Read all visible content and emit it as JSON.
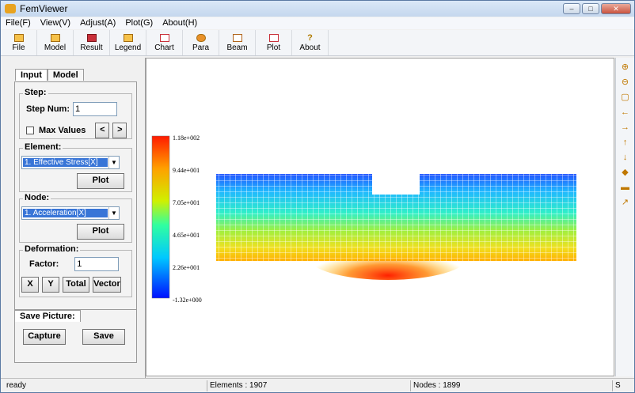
{
  "window": {
    "title": "FemViewer"
  },
  "menu": [
    "File(F)",
    "View(V)",
    "Adjust(A)",
    "Plot(G)",
    "About(H)"
  ],
  "toolbar": [
    {
      "label": "File",
      "icon": "open-folder-icon"
    },
    {
      "label": "Model",
      "icon": "model-icon"
    },
    {
      "label": "Result",
      "icon": "result-icon"
    },
    {
      "label": "Legend",
      "icon": "legend-icon"
    },
    {
      "label": "Chart",
      "icon": "chart-icon"
    },
    {
      "label": "Para",
      "icon": "para-icon"
    },
    {
      "label": "Beam",
      "icon": "beam-icon"
    },
    {
      "label": "Plot",
      "icon": "plot-icon"
    },
    {
      "label": "About",
      "icon": "about-icon"
    }
  ],
  "tabs": {
    "input": "Input",
    "model": "Model"
  },
  "step": {
    "group_label": "Step:",
    "step_num_label": "Step Num:",
    "step_num_value": "1",
    "max_values_label": "Max Values",
    "prev": "<",
    "next": ">"
  },
  "element": {
    "group_label": "Element:",
    "selected": "1. Effective Stress[X]",
    "plot": "Plot"
  },
  "node": {
    "group_label": "Node:",
    "selected": "1. Acceleration[X]",
    "plot": "Plot"
  },
  "deformation": {
    "group_label": "Deformation:",
    "factor_label": "Factor:",
    "factor_value": "1",
    "x": "X",
    "y": "Y",
    "total": "Total",
    "vector": "Vector"
  },
  "save": {
    "label": "Save Picture:",
    "capture": "Capture",
    "save": "Save"
  },
  "legend": {
    "ticks": [
      "1.18e+002",
      "9.44e+001",
      "7.05e+001",
      "4.65e+001",
      "2.26e+001",
      "-1.32e+000"
    ]
  },
  "status": {
    "left": "ready",
    "elements": "Elements : 1907",
    "nodes": "Nodes : 1899",
    "s": "S"
  },
  "right_tools": [
    "zoom-in-icon",
    "zoom-out-icon",
    "fit-icon",
    "pan-left-icon",
    "pan-right-icon",
    "pan-up-icon",
    "pan-down-icon",
    "dot-icon",
    "rect-icon",
    "diagonal-arrow-icon"
  ]
}
